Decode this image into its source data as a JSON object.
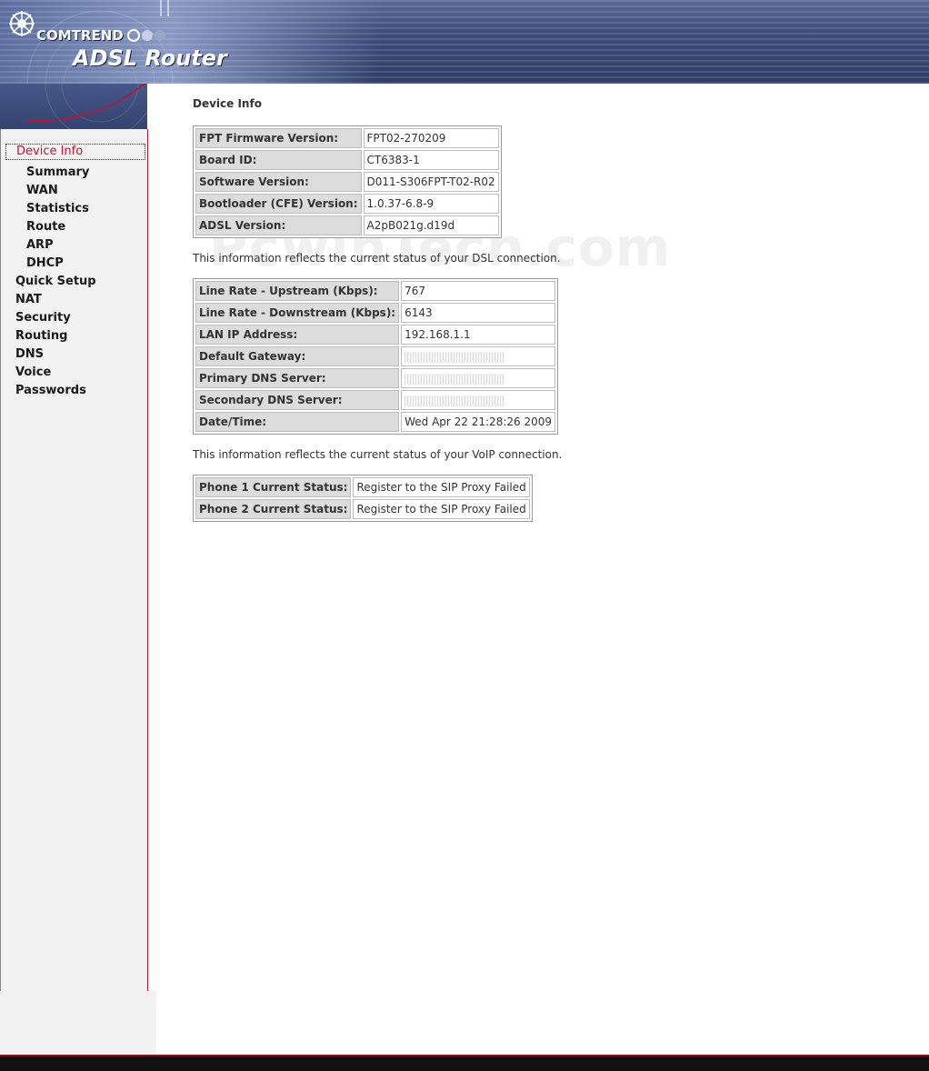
{
  "header": {
    "brand": "COMTREND",
    "product": "ADSL Router"
  },
  "sidebar": {
    "items": [
      {
        "label": "Device Info",
        "level": "top",
        "active": true
      },
      {
        "label": "Summary",
        "level": "sub"
      },
      {
        "label": "WAN",
        "level": "sub"
      },
      {
        "label": "Statistics",
        "level": "sub"
      },
      {
        "label": "Route",
        "level": "sub"
      },
      {
        "label": "ARP",
        "level": "sub"
      },
      {
        "label": "DHCP",
        "level": "sub"
      },
      {
        "label": "Quick Setup",
        "level": "top"
      },
      {
        "label": "NAT",
        "level": "top"
      },
      {
        "label": "Security",
        "level": "top"
      },
      {
        "label": "Routing",
        "level": "top"
      },
      {
        "label": "DNS",
        "level": "top"
      },
      {
        "label": "Voice",
        "level": "top"
      },
      {
        "label": "Passwords",
        "level": "top"
      }
    ]
  },
  "main": {
    "title": "Device Info",
    "device_table": [
      {
        "label": "FPT Firmware Version:",
        "value": "FPT02-270209"
      },
      {
        "label": "Board ID:",
        "value": "CT6383-1"
      },
      {
        "label": "Software Version:",
        "value": "D011-S306FPT-T02-R02"
      },
      {
        "label": "Bootloader (CFE) Version:",
        "value": "1.0.37-6.8-9"
      },
      {
        "label": "ADSL Version:",
        "value": "A2pB021g.d19d"
      }
    ],
    "dsl_note": "This information reflects the current status of your DSL connection.",
    "dsl_table": [
      {
        "label": "Line Rate - Upstream (Kbps):",
        "value": "767"
      },
      {
        "label": "Line Rate - Downstream (Kbps):",
        "value": "6143"
      },
      {
        "label": "LAN IP Address:",
        "value": "192.168.1.1"
      },
      {
        "label": "Default Gateway:",
        "value": ""
      },
      {
        "label": "Primary DNS Server:",
        "value": ""
      },
      {
        "label": "Secondary DNS Server:",
        "value": ""
      },
      {
        "label": "Date/Time:",
        "value": "Wed Apr 22 21:28:26 2009"
      }
    ],
    "voip_note": "This information reflects the current status of your VoIP connection.",
    "voip_table": [
      {
        "label": "Phone 1 Current Status:",
        "value": "Register to the SIP Proxy Failed"
      },
      {
        "label": "Phone 2 Current Status:",
        "value": "Register to the SIP Proxy Failed"
      }
    ]
  },
  "watermark": "PcwinTech.com",
  "colors": {
    "accent": "#c8102e",
    "banner": "#3d4d7a",
    "sidebar_bg": "#f2f2f2",
    "label_bg": "#dcdcdc"
  }
}
